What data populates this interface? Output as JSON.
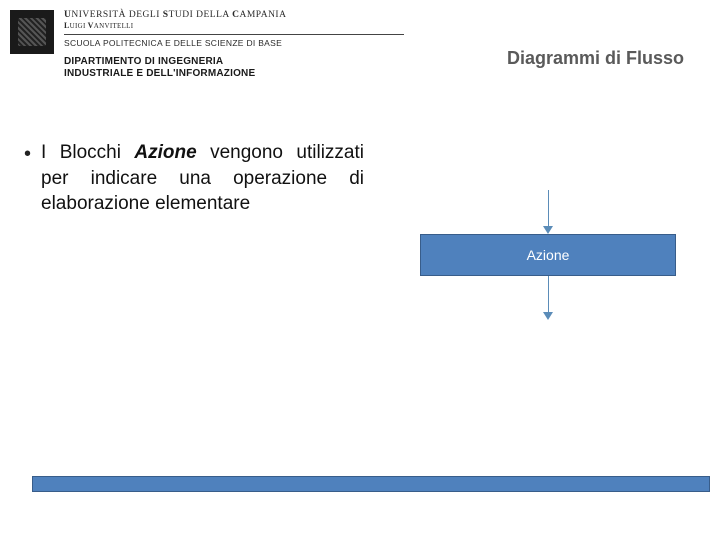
{
  "header": {
    "university_line1_prefix": "U",
    "university_line1_rest": "NIVERSITÀ DEGLI ",
    "university_line1_s": "S",
    "university_line1_rest2": "TUDI DELLA ",
    "university_line1_c": "C",
    "university_line1_rest3": "AMPANIA",
    "luigi_l": "L",
    "luigi_rest": "UIGI ",
    "vanvitelli_v": "V",
    "vanvitelli_rest": "ANVITELLI",
    "school": "SCUOLA POLITECNICA E DELLE SCIENZE DI BASE",
    "dept_line1": "DIPARTIMENTO DI INGEGNERIA",
    "dept_line2": "INDUSTRIALE E DELL'INFORMAZIONE"
  },
  "slide_title": "Diagrammi di Flusso",
  "content": {
    "bullet_prefix": "I Blocchi ",
    "bullet_emph": "Azione",
    "bullet_suffix": " vengono utilizzati per indicare una operazione di elaborazione elementare"
  },
  "diagram": {
    "box_label": "Azione"
  }
}
